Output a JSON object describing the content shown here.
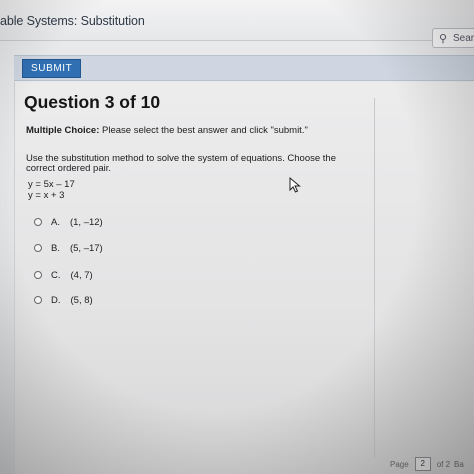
{
  "window": {
    "title": "able Systems: Substitution"
  },
  "search": {
    "label": "Searc"
  },
  "toolbar": {
    "submit_label": "SUBMIT"
  },
  "question": {
    "title": "Question 3 of 10",
    "type_label": "Multiple Choice:",
    "type_instructions": "Please select the best answer and click \"submit.\"",
    "prompt": "Use the substitution method to solve the system of equations. Choose the correct ordered pair.",
    "equations": [
      "y = 5x – 17",
      "y = x + 3"
    ]
  },
  "options": [
    {
      "letter": "A.",
      "value": "(1, –12)"
    },
    {
      "letter": "B.",
      "value": "(5, –17)"
    },
    {
      "letter": "C.",
      "value": "(4, 7)"
    },
    {
      "letter": "D.",
      "value": "(5, 8)"
    }
  ],
  "pager": {
    "label": "Page",
    "current": "2",
    "of_label": "of 2",
    "extra": "Ba"
  },
  "colors": {
    "accent": "#2f6fb2",
    "background": "#e6e7e9"
  },
  "icons": {
    "search": "search-icon",
    "cursor": "mouse-pointer-icon"
  }
}
